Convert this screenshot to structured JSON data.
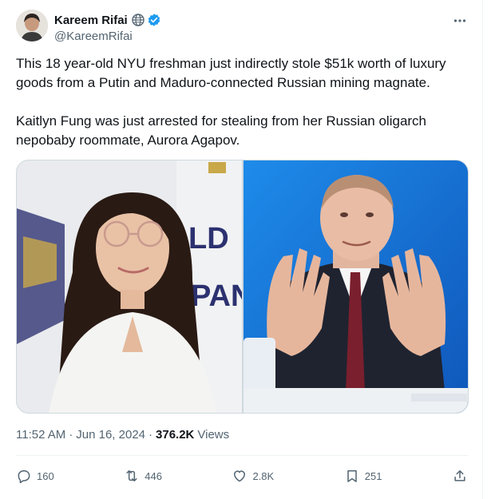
{
  "author": {
    "display_name": "Kareem Rifai",
    "handle": "@KareemRifai",
    "badges": [
      "globe-icon",
      "verified-icon"
    ]
  },
  "tweet": {
    "paragraphs": [
      "This 18 year-old NYU freshman just indirectly stole $51k worth of luxury goods from a Putin and Maduro-connected Russian mining magnate.",
      "Kaitlyn Fung was just arrested for stealing from her Russian oligarch nepobaby roommate, Aurora Agapov."
    ]
  },
  "meta": {
    "time": "11:52 AM",
    "separator": "·",
    "date": "Jun 16, 2024",
    "views_count": "376.2K",
    "views_label": "Views"
  },
  "actions": {
    "reply_count": "160",
    "retweet_count": "446",
    "like_count": "2.8K",
    "bookmark_count": "251"
  },
  "colors": {
    "text": "#0f1419",
    "secondary": "#536471",
    "verified": "#1d9bf0",
    "divider": "#eff3f4"
  }
}
